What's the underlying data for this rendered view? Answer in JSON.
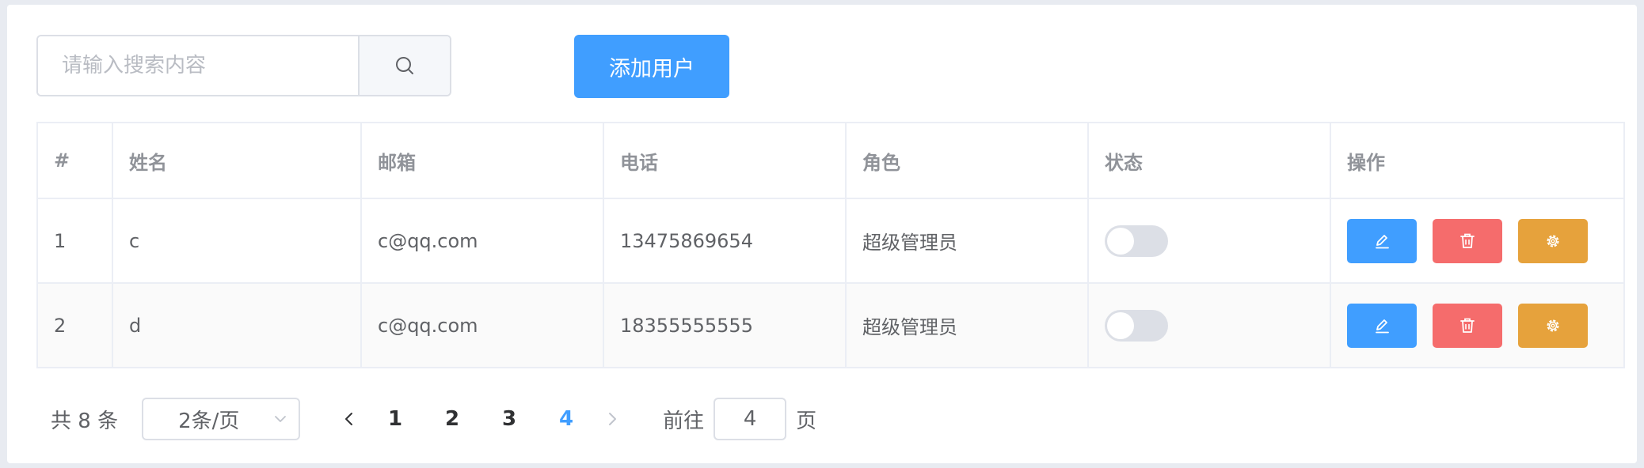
{
  "toolbar": {
    "search_placeholder": "请输入搜索内容",
    "search_icon": "search-icon",
    "add_user_label": "添加用户"
  },
  "table": {
    "headers": [
      "#",
      "姓名",
      "邮箱",
      "电话",
      "角色",
      "状态",
      "操作"
    ],
    "rows": [
      {
        "index": "1",
        "name": "c",
        "email": "c@qq.com",
        "phone": "13475869654",
        "role": "超级管理员",
        "status_on": false
      },
      {
        "index": "2",
        "name": "d",
        "email": "c@qq.com",
        "phone": "18355555555",
        "role": "超级管理员",
        "status_on": false
      }
    ],
    "action_icons": [
      "edit-icon",
      "delete-icon",
      "setting-icon"
    ]
  },
  "pagination": {
    "total_label": "共 8 条",
    "page_size": "2条/页",
    "pages": [
      "1",
      "2",
      "3",
      "4"
    ],
    "current_page": "4",
    "goto_label": "前往",
    "goto_value": "4",
    "page_suffix": "页"
  },
  "colors": {
    "primary": "#409eff",
    "danger": "#f56c6c",
    "warning": "#e6a23c",
    "switch_off": "#dcdfe6"
  }
}
